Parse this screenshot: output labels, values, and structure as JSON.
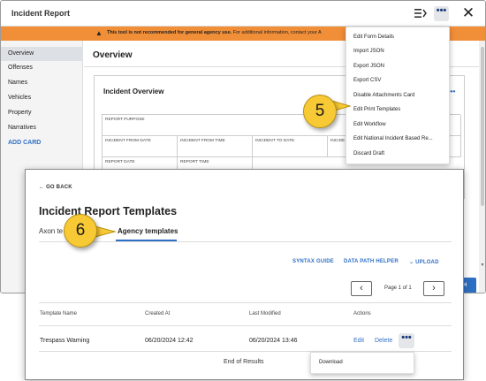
{
  "background_window": {
    "title": "Incident Report",
    "header_more_glyph": "•••",
    "header_close_glyph": "✕",
    "banner": {
      "warning_glyph": "▲",
      "bold_text": "This tool is not recommended for general agency use.",
      "text": " For additional information, contact your A"
    },
    "nav": [
      "Overview",
      "Offenses",
      "Names",
      "Vehicles",
      "Property",
      "Narratives"
    ],
    "add_card": "ADD CARD",
    "page_title": "Overview",
    "card": {
      "title": "Incident Overview",
      "more_glyph": "•••",
      "fields": {
        "report_purpose": "REPORT PURPOSE",
        "incident_from_date": "INCIDENT FROM DATE",
        "incident_from_time": "INCIDENT FROM TIME",
        "incident_to_date": "INCIDENT TO DATE",
        "incide": "INCIDE",
        "report_date": "REPORT DATE",
        "report_time": "REPORT TIME"
      }
    },
    "save_button_fragment": "H"
  },
  "dropdown_menu": {
    "items": [
      "Edit Form Details",
      "Import JSON",
      "Export JSON",
      "Export CSV",
      "Disable Attachments Card",
      "Edit Print Templates",
      "Edit Workflow",
      "Edit National Incident Based Re...",
      "Discard Draft"
    ]
  },
  "callouts": {
    "five": "5",
    "six": "6"
  },
  "templates_window": {
    "back_label": "← GO BACK",
    "title": "Incident Report Templates",
    "tab_axon": "Axon te",
    "tab_agency": "Agency templates",
    "links": {
      "syntax_guide": "SYNTAX GUIDE",
      "data_path_helper": "DATA PATH HELPER",
      "upload": "⌄ UPLOAD"
    },
    "pagination": {
      "prev_glyph": "‹",
      "next_glyph": "›",
      "text": "Page 1 of 1"
    },
    "table": {
      "headers": [
        "Template Name",
        "Created At",
        "Last Modified",
        "Actions"
      ],
      "rows": [
        {
          "name": "Trespass Warning",
          "created_at": "06/20/2024 12:42",
          "last_modified": "06/20/2024 13:46",
          "edit": "Edit",
          "delete": "Delete",
          "more_glyph": "•••"
        }
      ],
      "end_text": "End of Results"
    },
    "row_menu": {
      "items": [
        "Download"
      ]
    }
  }
}
